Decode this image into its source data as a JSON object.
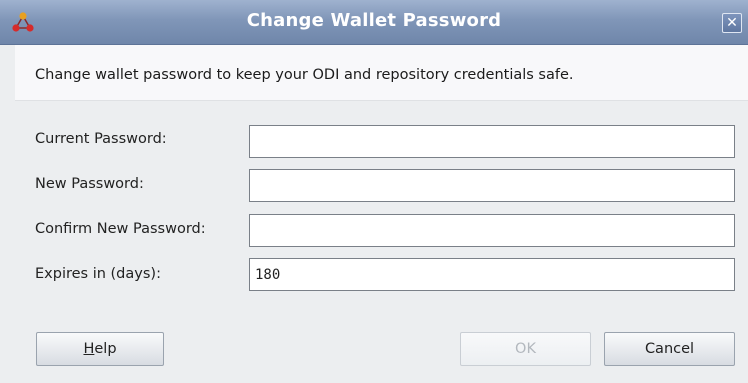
{
  "window": {
    "title": "Change Wallet Password",
    "close_glyph": "✕"
  },
  "banner": {
    "text": "Change wallet password to keep your ODI and repository credentials safe."
  },
  "form": {
    "current_password": {
      "label": "Current Password:",
      "value": ""
    },
    "new_password": {
      "label": "New Password:",
      "value": ""
    },
    "confirm_password": {
      "label": "Confirm New Password:",
      "value": ""
    },
    "expires": {
      "label": "Expires in (days):",
      "value": "180"
    }
  },
  "buttons": {
    "help": {
      "mnemonic": "H",
      "rest": "elp"
    },
    "ok": "OK",
    "cancel": "Cancel"
  },
  "icons": {
    "app": "odi-app-icon",
    "close": "close-icon"
  },
  "colors": {
    "titlebar": "#8096b8",
    "ok_disabled_text": "#b3b8be"
  }
}
